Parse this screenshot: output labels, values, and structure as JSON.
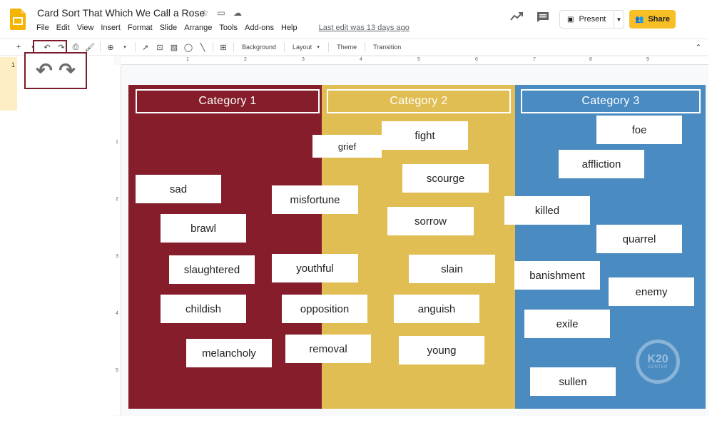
{
  "header": {
    "title": "Card Sort That Which We Call a Rose",
    "menus": [
      "File",
      "Edit",
      "View",
      "Insert",
      "Format",
      "Slide",
      "Arrange",
      "Tools",
      "Add-ons",
      "Help"
    ],
    "last_edit": "Last edit was 13 days ago",
    "present_label": "Present",
    "share_label": "Share"
  },
  "toolbar": {
    "background_label": "Background",
    "layout_label": "Layout",
    "theme_label": "Theme",
    "transition_label": "Transition"
  },
  "filmstrip": {
    "slide_number": "1"
  },
  "rulers": {
    "horizontal": [
      "1",
      "2",
      "3",
      "4",
      "5",
      "6",
      "7",
      "8",
      "9"
    ],
    "vertical": [
      "1",
      "2",
      "3",
      "4",
      "5"
    ]
  },
  "slide": {
    "categories": [
      "Category  1",
      "Category  2",
      "Category  3"
    ],
    "cards": [
      "grief",
      "fight",
      "foe",
      "affliction",
      "scourge",
      "sad",
      "misfortune",
      "killed",
      "brawl",
      "sorrow",
      "quarrel",
      "slaughtered",
      "youthful",
      "slain",
      "banishment",
      "enemy",
      "childish",
      "opposition",
      "anguish",
      "exile",
      "melancholy",
      "removal",
      "young",
      "sullen"
    ],
    "logo": {
      "main": "K20",
      "sub": "CENTER"
    }
  },
  "colors": {
    "category_1": "#851d2b",
    "category_2": "#e1be53",
    "category_3": "#4a8bc2",
    "share_button": "#f6bf26",
    "highlight_border": "#7a1a2a"
  }
}
